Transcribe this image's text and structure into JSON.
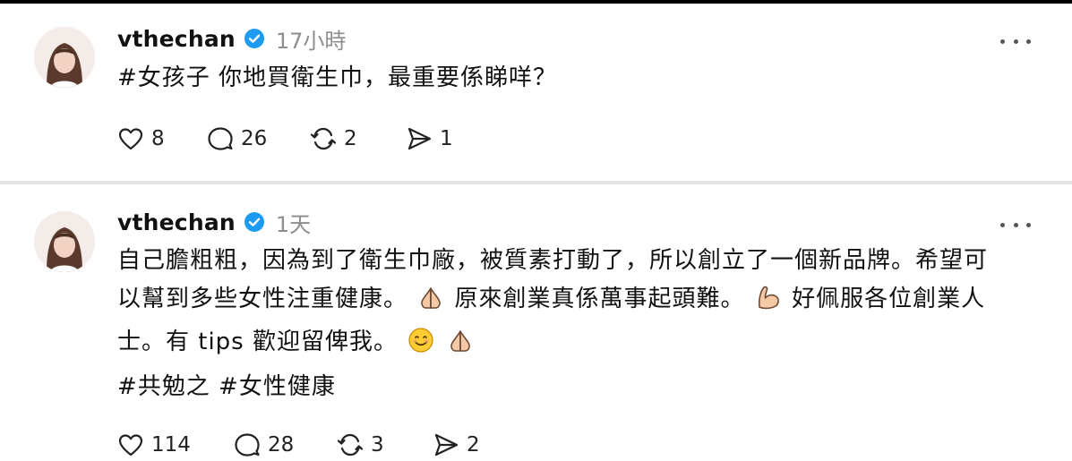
{
  "posts": [
    {
      "username": "vthechan",
      "time": "17小時",
      "text_lines": [
        "#女孩子 你地買衛生巾，最重要係睇咩？"
      ],
      "likes": "8",
      "replies": "26",
      "reposts": "2",
      "shares": "1"
    },
    {
      "username": "vthechan",
      "time": "1天",
      "text_line1": "自己膽粗粗，因為到了衛生巾廠，被質素打動了，所以創立了一個新品牌。希望可",
      "text_line2a": "以幫到多些女性注重健康。",
      "text_line2b": "原來創業真係萬事起頭難。",
      "text_line2c": "好佩服各位創業人",
      "text_line3": "士。有 tips 歡迎留俾我。",
      "tags": "#共勉之 #女性健康",
      "likes": "114",
      "replies": "28",
      "reposts": "3",
      "shares": "2"
    }
  ],
  "icons": {
    "verified": "verified-badge-icon",
    "like": "heart-icon",
    "reply": "speech-bubble-icon",
    "repost": "repost-arrows-icon",
    "share": "send-icon",
    "more": "more-dots-icon",
    "emoji_pray": "folded-hands-emoji",
    "emoji_flex": "flexed-biceps-emoji",
    "emoji_smile": "smiling-face-emoji"
  },
  "colors": {
    "verified_blue": "#1d9bf0",
    "timestamp_gray": "#8d8d8d",
    "text": "#111111"
  }
}
